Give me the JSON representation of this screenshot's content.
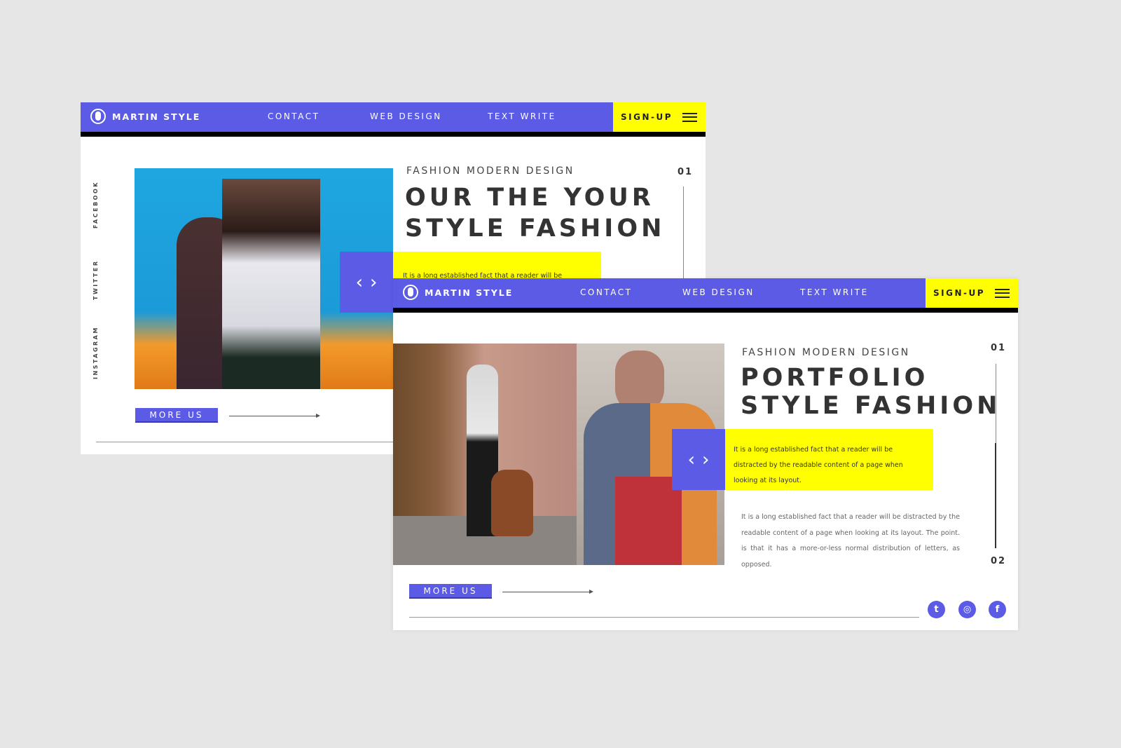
{
  "colors": {
    "accent": "#5b5be6",
    "highlight": "#ffff00",
    "background": "#e6e6e6"
  },
  "slide1": {
    "brand": "MARTIN STYLE",
    "nav": [
      "CONTACT",
      "WEB DESIGN",
      "TEXT WRITE"
    ],
    "signup": "SIGN-UP",
    "social_labels": [
      "FACEBOOK",
      "TWITTER",
      "INSTAGRAM"
    ],
    "subtitle": "FASHION MODERN DESIGN",
    "title_line1": "OUR THE YOUR",
    "title_line2": "STYLE FASHION",
    "page_num": "01",
    "highlight_text": "It is a long established fact that a reader will be distracted by",
    "prev": "‹",
    "next": "›",
    "more_button": "MORE US"
  },
  "slide2": {
    "brand": "MARTIN STYLE",
    "nav": [
      "CONTACT",
      "WEB DESIGN",
      "TEXT WRITE"
    ],
    "signup": "SIGN-UP",
    "subtitle": "FASHION MODERN DESIGN",
    "title_line1": "PORTFOLIO",
    "title_line2": "STYLE FASHION",
    "page_num_top": "01",
    "page_num_bottom": "02",
    "highlight_text": "It is a long established fact that a reader will be distracted by the readable content of a page when looking at its layout.",
    "body_text": "It is a long established fact that a reader will be distracted by the readable content of a page when looking at its layout. The point. is that it has a more-or-less normal distribution of letters, as opposed.",
    "prev": "‹",
    "next": "›",
    "more_button": "MORE US",
    "social_icons": [
      "twitter-icon",
      "instagram-icon",
      "facebook-icon"
    ],
    "social_glyphs": [
      "t",
      "◎",
      "f"
    ]
  }
}
